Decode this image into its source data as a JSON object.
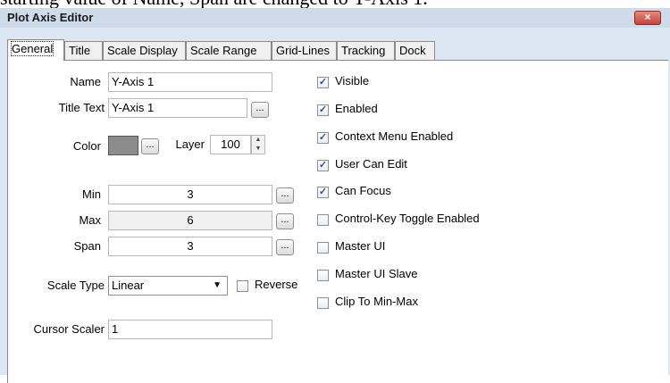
{
  "caption_fragment": "starting value of Name, Span are changed to Y-Axis 1.",
  "window": {
    "title": "Plot Axis Editor",
    "close_glyph": "×"
  },
  "tabs": [
    {
      "label": "General",
      "active": true
    },
    {
      "label": "Title"
    },
    {
      "label": "Scale Display"
    },
    {
      "label": "Scale Range"
    },
    {
      "label": "Grid-Lines"
    },
    {
      "label": "Tracking"
    },
    {
      "label": "Dock"
    }
  ],
  "form": {
    "name_label": "Name",
    "name_value": "Y-Axis 1",
    "title_text_label": "Title Text",
    "title_text_value": "Y-Axis 1",
    "color_label": "Color",
    "color_value": "#8c8c8c",
    "layer_label": "Layer",
    "layer_value": "100",
    "min_label": "Min",
    "min_value": "3",
    "max_label": "Max",
    "max_value": "6",
    "span_label": "Span",
    "span_value": "3",
    "scale_type_label": "Scale Type",
    "scale_type_value": "Linear",
    "reverse_label": "Reverse",
    "cursor_scaler_label": "Cursor Scaler",
    "cursor_scaler_value": "1",
    "browse_glyph": "..."
  },
  "checkboxes": [
    {
      "label": "Visible",
      "checked": true
    },
    {
      "label": "Enabled",
      "checked": true
    },
    {
      "label": "Context Menu Enabled",
      "checked": true
    },
    {
      "label": "User Can Edit",
      "checked": true
    },
    {
      "label": "Can Focus",
      "checked": true
    },
    {
      "label": "Control-Key Toggle Enabled",
      "checked": false
    },
    {
      "label": "Master UI",
      "checked": false
    },
    {
      "label": "Master UI Slave",
      "checked": false
    },
    {
      "label": "Clip To Min-Max",
      "checked": false
    }
  ]
}
